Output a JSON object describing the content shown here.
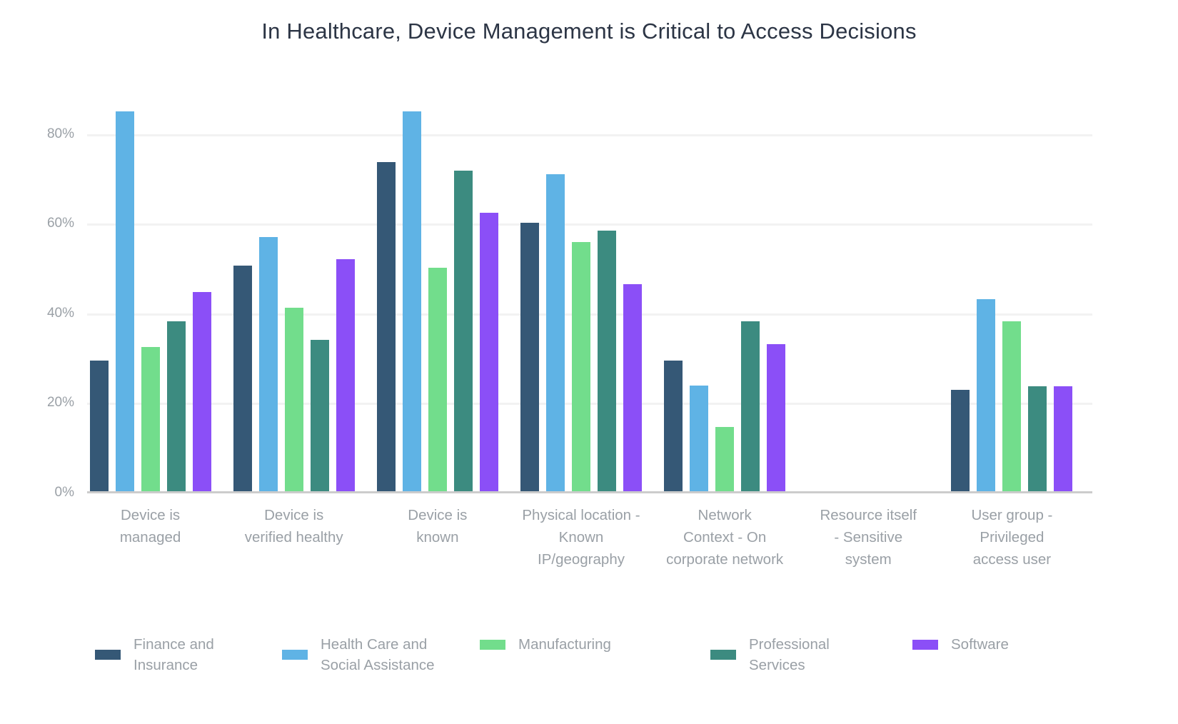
{
  "chart_data": {
    "type": "bar",
    "title": "In Healthcare, Device Management is Critical to Access Decisions",
    "xlabel": "",
    "ylabel": "",
    "ylim": [
      0,
      90
    ],
    "grid": true,
    "legend_position": "bottom",
    "y_ticks": [
      "0%",
      "20%",
      "40%",
      "60%",
      "80%"
    ],
    "y_tick_values": [
      0,
      20,
      40,
      60,
      80
    ],
    "categories": [
      "Device is managed",
      "Device is verified healthy",
      "Device is known",
      "Physical location - Known IP/geography",
      "Network Context - On corporate network",
      "Resource itself - Sensitive system",
      "User group - Privileged access user"
    ],
    "category_lines": [
      [
        "Device is",
        "managed"
      ],
      [
        "Device is",
        "verified healthy"
      ],
      [
        "Device is",
        "known"
      ],
      [
        "Physical location -",
        "Known",
        "IP/geography"
      ],
      [
        "Network",
        "Context - On",
        "corporate network"
      ],
      [
        "Resource itself",
        "- Sensitive",
        "system"
      ],
      [
        "User group -",
        "Privileged",
        "access user"
      ]
    ],
    "series": [
      {
        "name": "Finance and Insurance",
        "name_lines": [
          "Finance and",
          "Insurance"
        ],
        "color": "#355876",
        "values": [
          29.5,
          50.7,
          73.7,
          60.2,
          29.4,
          0,
          23.0
        ]
      },
      {
        "name": "Health Care and Social Assistance",
        "name_lines": [
          "Health Care and",
          "Social Assistance"
        ],
        "color": "#5FB3E5",
        "values": [
          85.1,
          57.1,
          85.1,
          71.1,
          23.9,
          0,
          43.1
        ]
      },
      {
        "name": "Manufacturing",
        "name_lines": [
          "Manufacturing"
        ],
        "color": "#72DD8C",
        "values": [
          32.5,
          41.2,
          50.2,
          55.9,
          14.7,
          0,
          38.2
        ]
      },
      {
        "name": "Professional Services",
        "name_lines": [
          "Professional",
          "Services"
        ],
        "color": "#3C8B80",
        "values": [
          38.2,
          34.1,
          71.9,
          58.4,
          38.2,
          0,
          23.8
        ]
      },
      {
        "name": "Software",
        "name_lines": [
          "Software"
        ],
        "color": "#8B4FF7",
        "values": [
          44.8,
          52.1,
          62.4,
          46.5,
          33.1,
          0,
          23.8
        ]
      }
    ]
  },
  "colors": {
    "background": "#ffffff",
    "title": "#2c3545",
    "tick_text": "#9aa0a6",
    "gridline": "#f2f2f2",
    "axis_line": "#cccccc"
  }
}
